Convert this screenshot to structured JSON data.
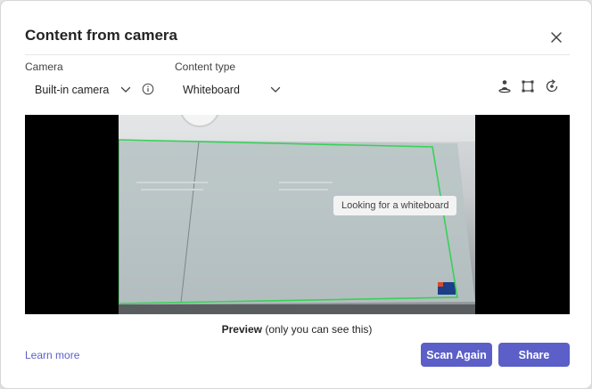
{
  "dialog": {
    "title": "Content from camera",
    "close_icon": "close-icon"
  },
  "camera": {
    "label": "Camera",
    "selected": "Built-in camera",
    "info_icon": "info-icon"
  },
  "content_type": {
    "label": "Content type",
    "selected": "Whiteboard"
  },
  "tools": [
    {
      "icon": "person-stand-icon"
    },
    {
      "icon": "crop-corners-icon"
    },
    {
      "icon": "rotate-icon"
    }
  ],
  "preview": {
    "status": "Looking for a whiteboard",
    "caption_bold": "Preview",
    "caption_rest": " (only you can see this)"
  },
  "footer": {
    "learn_more": "Learn more",
    "scan_again": "Scan Again",
    "share": "Share"
  },
  "colors": {
    "accent": "#5b5fc7",
    "detect_outline": "#37d158"
  }
}
